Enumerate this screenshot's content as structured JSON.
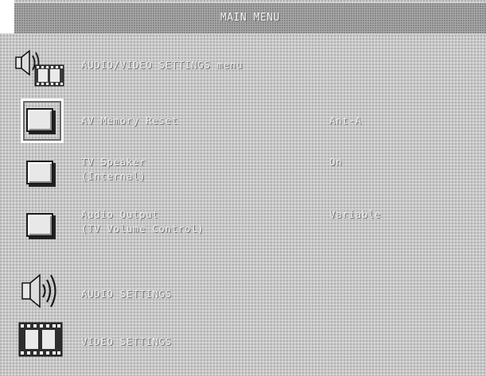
{
  "menu": {
    "title": "MAIN MENU"
  },
  "items": [
    {
      "label": "AUDIO/VIDEO SETTINGS menu",
      "icon": "av-settings-icon"
    },
    {
      "label": "AV Memory Reset",
      "value": "Ant-A",
      "icon": "square-button-icon",
      "selected": true
    },
    {
      "label": "TV Speaker",
      "label2": "(Internal)",
      "value": "On",
      "icon": "square-button-icon"
    },
    {
      "label": "Audio Output",
      "label2": "(TV Volume Control)",
      "value": "Variable",
      "icon": "square-button-icon"
    },
    {
      "label": "AUDIO SETTINGS",
      "icon": "speaker-icon"
    },
    {
      "label": "VIDEO SETTINGS",
      "icon": "film-icon"
    }
  ],
  "colors": {
    "background": "#c9c9c9",
    "title_bar": "#a8a8a8",
    "text": "#efefef"
  }
}
